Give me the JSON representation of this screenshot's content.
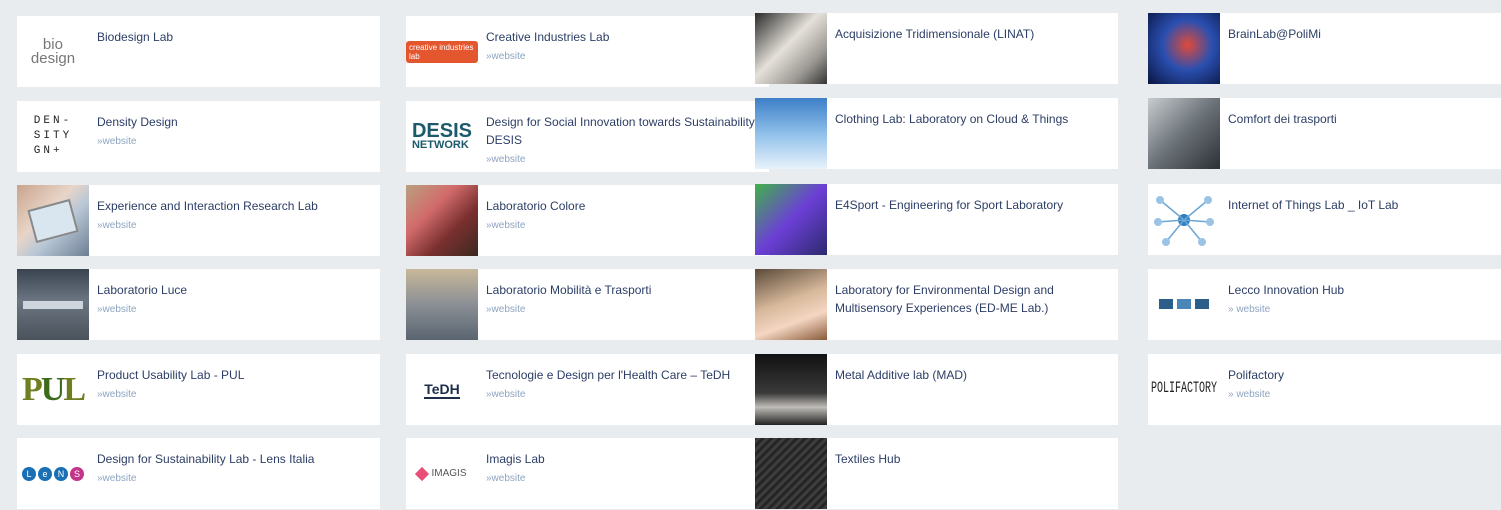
{
  "labs": [
    {
      "title": "Biodesign Lab",
      "link": "",
      "thumb": "biodesign-logo",
      "thumb_text": "bio\ndesign"
    },
    {
      "title": "Creative Industries Lab",
      "link": "»website",
      "thumb": "creative-industries-logo",
      "thumb_text": "creative industries lab"
    },
    {
      "title": "Acquisizione Tridimensionale (LINAT)",
      "link": "",
      "thumb": "sculpture-photo"
    },
    {
      "title": "BrainLab@PoliMi",
      "link": "",
      "thumb": "brain-scan-photo"
    },
    {
      "title": "Density Design",
      "link": "»website",
      "thumb": "density-design-logo",
      "thumb_text": "DEN-\nSITY\nGN+"
    },
    {
      "title": "Design for Social Innovation towards Sustainability – DESIS",
      "link": "»website",
      "thumb": "desis-network-logo",
      "thumb_text": "DESIS\nNETWORK"
    },
    {
      "title": "Clothing Lab: Laboratory on Cloud & Things",
      "link": "",
      "thumb": "cloud-hand-photo"
    },
    {
      "title": "Comfort dei trasporti",
      "link": "",
      "thumb": "car-interior-photo"
    },
    {
      "title": "Experience and Interaction Research Lab",
      "link": "»website",
      "thumb": "interaction-photo"
    },
    {
      "title": "Laboratorio Colore",
      "link": "»website",
      "thumb": "color-swatches-photo"
    },
    {
      "title": "E4Sport - Engineering for Sport Laboratory",
      "link": "",
      "thumb": "sport-3d-photo"
    },
    {
      "title": "Internet of Things Lab _ IoT Lab",
      "link": "",
      "thumb": "iot-diagram"
    },
    {
      "title": "Laboratorio Luce",
      "link": "»website",
      "thumb": "lighting-room-photo"
    },
    {
      "title": "Laboratorio Mobilità e Trasporti",
      "link": "»website",
      "thumb": "mobility-photo"
    },
    {
      "title": "Laboratory for Environmental Design and Multisensory Experiences (ED-ME Lab.)",
      "link": "",
      "thumb": "light-fibers-photo"
    },
    {
      "title": "Lecco Innovation Hub",
      "link": "» website",
      "thumb": "lecco-hub-logo"
    },
    {
      "title": "Product Usability Lab - PUL",
      "link": "»website",
      "thumb": "pul-logo",
      "thumb_text": "PUL"
    },
    {
      "title": "Tecnologie e Design per l'Health Care – TeDH",
      "link": "»website",
      "thumb": "tedh-logo",
      "thumb_text": "TeDH"
    },
    {
      "title": "Metal Additive lab (MAD)",
      "link": "",
      "thumb": "metal-printing-photo"
    },
    {
      "title": "Polifactory",
      "link": "» website",
      "thumb": "polifactory-logo",
      "thumb_text": "POLIFACTORY"
    },
    {
      "title": "Design for Sustainability Lab - Lens Italia",
      "link": "»website",
      "thumb": "lens-logo",
      "thumb_text": "LeNS"
    },
    {
      "title": "Imagis Lab",
      "link": "»website",
      "thumb": "imagis-logo",
      "thumb_text": "IMAGIS"
    },
    {
      "title": "Textiles Hub",
      "link": "",
      "thumb": "textile-photo"
    }
  ],
  "colors": {
    "page_bg": "#e9ecef",
    "card_bg": "#ffffff",
    "title": "#2c3e66",
    "link": "#8ea4c0"
  }
}
